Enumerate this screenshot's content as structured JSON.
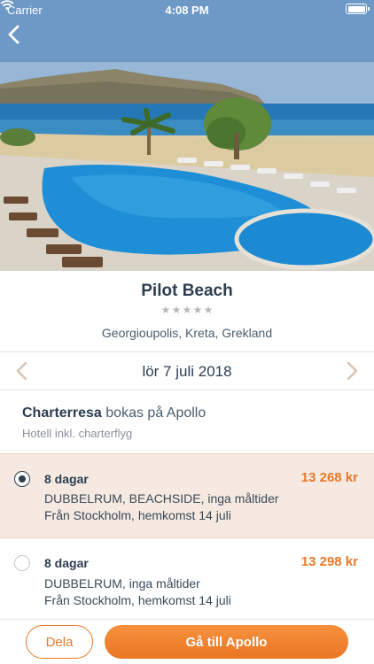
{
  "status_bar": {
    "carrier": "Carrier",
    "time": "4:08 PM"
  },
  "hero": {
    "photo": "hotel-pool-beach-photo",
    "back_icon": "chevron-left-icon"
  },
  "hotel": {
    "name": "Pilot Beach",
    "stars": 5,
    "location": "Georgioupolis, Kreta, Grekland"
  },
  "date_selector": {
    "date": "lör 7 juli 2018",
    "prev_icon": "chevron-left-icon",
    "next_icon": "chevron-right-icon"
  },
  "trip_type": {
    "type_bold": "Charterresa",
    "type_rest": " bokas på Apollo",
    "subtitle": "Hotell inkl. charterflyg"
  },
  "options": [
    {
      "selected": true,
      "days": "8 dagar",
      "price": "13 268 kr",
      "room": "DUBBELRUM, BEACHSIDE, inga måltider",
      "route": "Från Stockholm, hemkomst 14 juli"
    },
    {
      "selected": false,
      "days": "8 dagar",
      "price": "13 298 kr",
      "room": "DUBBELRUM, inga måltider",
      "route": "Från Stockholm, hemkomst 14 juli"
    }
  ],
  "footer": {
    "share_label": "Dela",
    "cta_label": "Gå till Apollo"
  },
  "colors": {
    "accent": "#e8792a",
    "text_dark": "#2c3e50",
    "selected_bg": "#f5e9e2"
  }
}
